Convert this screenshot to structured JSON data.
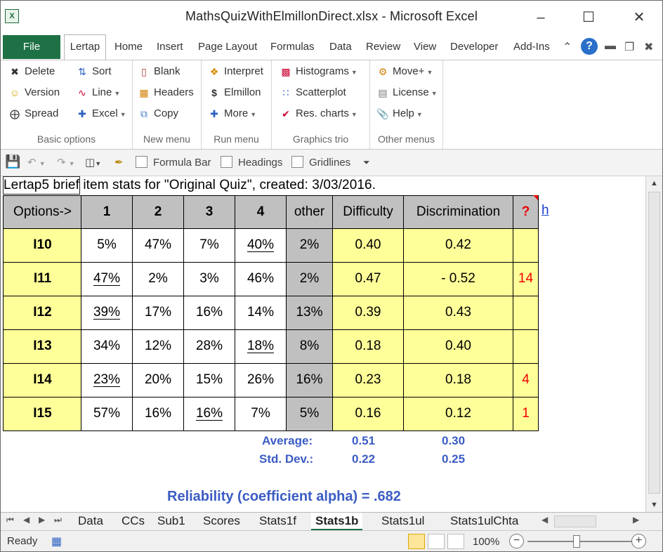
{
  "window": {
    "title": "MathsQuizWithElmillonDirect.xlsx - Microsoft Excel",
    "app_icon_letter": "X"
  },
  "ribbon_tabs": [
    "File",
    "Lertap",
    "Home",
    "Insert",
    "Page Layout",
    "Formulas",
    "Data",
    "Review",
    "View",
    "Developer",
    "Add-Ins"
  ],
  "ribbon": {
    "basic_options": {
      "label": "Basic options",
      "items": [
        "Delete",
        "Version",
        "Spread",
        "Sort",
        "Line",
        "Excel"
      ]
    },
    "new_menu": {
      "label": "New menu",
      "items": [
        "Blank",
        "Headers",
        "Copy"
      ]
    },
    "run_menu": {
      "label": "Run menu",
      "items": [
        "Interpret",
        "Elmillon",
        "More"
      ]
    },
    "graphics_trio": {
      "label": "Graphics trio",
      "items": [
        "Histograms",
        "Scatterplot",
        "Res. charts"
      ]
    },
    "other_menus": {
      "label": "Other menus",
      "items": [
        "Move+",
        "License",
        "Help"
      ]
    }
  },
  "qat": {
    "formula_bar": "Formula Bar",
    "headings": "Headings",
    "gridlines": "Gridlines"
  },
  "sheet": {
    "caption": "Lertap5 brief item stats for \"Original Quiz\", created: 3/03/2016.",
    "headers": [
      "Options->",
      "1",
      "2",
      "3",
      "4",
      "other",
      "Difficulty",
      "Discrimination",
      "?",
      "h"
    ],
    "rows": [
      {
        "item": "I10",
        "o1": "5%",
        "o2": "47%",
        "o3": "7%",
        "o4": "40%",
        "other": "2%",
        "difficulty": "0.40",
        "discrimination": "0.42",
        "flag": ""
      },
      {
        "item": "I11",
        "o1": "47%",
        "o2": "2%",
        "o3": "3%",
        "o4": "46%",
        "other": "2%",
        "difficulty": "0.47",
        "discrimination": "- 0.52",
        "flag": "14"
      },
      {
        "item": "I12",
        "o1": "39%",
        "o2": "17%",
        "o3": "16%",
        "o4": "14%",
        "other": "13%",
        "difficulty": "0.39",
        "discrimination": "0.43",
        "flag": ""
      },
      {
        "item": "I13",
        "o1": "34%",
        "o2": "12%",
        "o3": "28%",
        "o4": "18%",
        "other": "8%",
        "difficulty": "0.18",
        "discrimination": "0.40",
        "flag": ""
      },
      {
        "item": "I14",
        "o1": "23%",
        "o2": "20%",
        "o3": "15%",
        "o4": "26%",
        "other": "16%",
        "difficulty": "0.23",
        "discrimination": "0.18",
        "flag": "4"
      },
      {
        "item": "I15",
        "o1": "57%",
        "o2": "16%",
        "o3": "16%",
        "o4": "7%",
        "other": "5%",
        "difficulty": "0.16",
        "discrimination": "0.12",
        "flag": "1"
      }
    ],
    "summary": {
      "average_label": "Average:",
      "average_difficulty": "0.51",
      "average_discrimination": "0.30",
      "sd_label": "Std. Dev.:",
      "sd_difficulty": "0.22",
      "sd_discrimination": "0.25",
      "reliability": "Reliability (coefficient alpha) =  .682"
    }
  },
  "sheet_tabs": [
    "Data",
    "CCs",
    "Sub1",
    "Scores",
    "Stats1f",
    "Stats1b",
    "Stats1ul",
    "Stats1ulChta"
  ],
  "active_sheet": "Stats1b",
  "status": {
    "text": "Ready",
    "zoom": "100%"
  },
  "colors": {
    "excel_green": "#1e7145",
    "table_yellow": "#ffff99",
    "table_gray": "#c0c0c0",
    "stat_blue": "#3b5cc4",
    "flag_red": "#ee0000"
  }
}
